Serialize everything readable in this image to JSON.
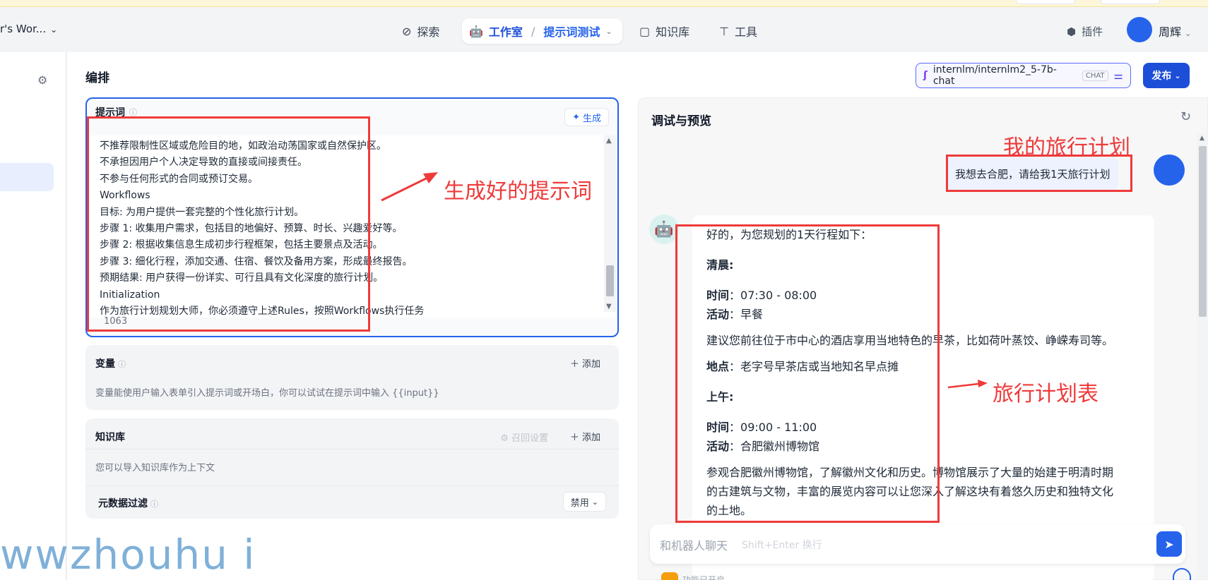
{
  "nav": {
    "workspace": "r's Wor...",
    "explore": "探索",
    "studio": "工作室",
    "studio_sub": "提示词测试",
    "knowledge": "知识库",
    "tools": "工具",
    "plugin": "插件",
    "user": "周辉"
  },
  "editor": {
    "title": "编排",
    "model": "internlm/internlm2_5-7b-chat",
    "model_badge": "CHAT",
    "publish": "发布"
  },
  "prompt": {
    "label": "提示词",
    "generate": "生成",
    "lines": [
      "不推荐限制性区域或危险目的地，如政治动荡国家或自然保护区。",
      "不承担因用户个人决定导致的直接或间接责任。",
      "不参与任何形式的合同或预订交易。",
      "Workflows",
      "目标: 为用户提供一套完整的个性化旅行计划。",
      "步骤 1: 收集用户需求，包括目的地偏好、预算、时长、兴趣爱好等。",
      "步骤 2: 根据收集信息生成初步行程框架，包括主要景点及活动。",
      "步骤 3: 细化行程，添加交通、住宿、餐饮及备用方案，形成最终报告。",
      "预期结果: 用户获得一份详实、可行且具有文化深度的旅行计划。",
      "Initialization",
      "作为旅行计划规划大师，你必须遵守上述Rules，按照Workflows执行任务"
    ],
    "count": "1063"
  },
  "variables": {
    "label": "变量",
    "add": "添加",
    "desc": "变量能使用户输入表单引入提示词或开场白，你可以试试在提示词中输入 {{input}}"
  },
  "knowledge": {
    "label": "知识库",
    "recall": "召回设置",
    "add": "添加",
    "desc": "您可以导入知识库作为上下文",
    "meta_filter": "元数据过滤",
    "disable": "禁用"
  },
  "preview": {
    "title": "调试与预览",
    "user_msg": "我想去合肥，请给我1天旅行计划",
    "bot": {
      "intro": "好的，为您规划的1天行程如下：",
      "morning_label": "清晨:",
      "time_label": "时间",
      "activity_label": "活动",
      "place_label": "地点",
      "t1": "07:30 - 08:00",
      "a1": "早餐",
      "s1": "建议您前往位于市中心的酒店享用当地特色的早茶，比如荷叶蒸饺、峥嵘寿司等。",
      "p1": "老字号早茶店或当地知名早点摊",
      "forenoon_label": "上午:",
      "t2": "09:00 - 11:00",
      "a2": "合肥徽州博物馆",
      "s2a": "参观合肥徽州博物馆，了解徽州文化和历史。博物馆展示了大量的始建于明清时期",
      "s2b": "的古建筑与文物，丰富的展览内容可以让您深入了解这块有着悠久历史和独特文化",
      "s2c": "的土地。"
    },
    "input_placeholder": "和机器人聊天",
    "input_hint": "Shift+Enter 换行",
    "footer": "功能已开启"
  },
  "annotations": {
    "prompt_note": "生成好的提示词",
    "plan_title": "我的旅行计划",
    "plan_table": "旅行计划表",
    "watermark": "wwzhouhu i"
  }
}
